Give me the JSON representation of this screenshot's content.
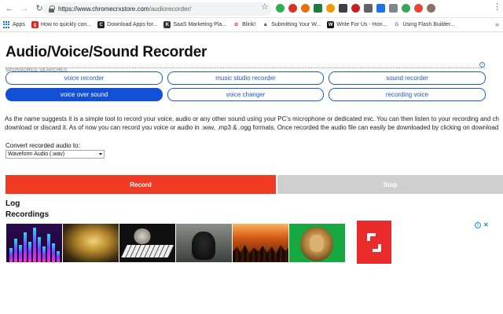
{
  "browser": {
    "url_host": "https://www.chromecrxstore.com",
    "url_path": "/audiorecorder/",
    "back_icon": "back-arrow-icon",
    "forward_icon": "forward-arrow-icon",
    "reload_icon": "reload-icon",
    "bookmarks": [
      {
        "label": "Apps",
        "favicon_color": "#1a73e8"
      },
      {
        "label": "How to quickly con...",
        "favicon_color": "#e62117",
        "favicon_text": "g"
      },
      {
        "label": "Download Apps for...",
        "favicon_color": "#222222",
        "favicon_text": "C"
      },
      {
        "label": "SaaS Marketing Pla...",
        "favicon_color": "#333333",
        "favicon_text": "K"
      },
      {
        "label": "Blink!",
        "favicon_color": "#ffffff",
        "favicon_text": "✿"
      },
      {
        "label": "Submitting Your W...",
        "favicon_color": "#ffffff",
        "favicon_text": "a"
      },
      {
        "label": "Write For Us - Hon...",
        "favicon_color": "#111111",
        "favicon_text": "W"
      },
      {
        "label": "Using Flash Builder...",
        "favicon_color": "#ffffff",
        "favicon_text": "G"
      }
    ],
    "more_label": "»"
  },
  "page": {
    "title": "Audio/Voice/Sound Recorder",
    "sponsored_label": "SPONSORED SEARCHES",
    "ad_links": [
      {
        "label": "voice recorder"
      },
      {
        "label": "music studio recorder"
      },
      {
        "label": "sound recorder"
      },
      {
        "label": "voice over sound"
      },
      {
        "label": "voice changer"
      },
      {
        "label": "recording voice"
      }
    ],
    "description_line1": "As the name suggests it is a simple tool to record your voice, audio or any other sound using your PC's microphone or dedicated mic. You can then listen to your recording and ch",
    "description_line2": "download or discard it. As of now you can record you voice or audio in .wav, .mp3 & .ogg formats. Once recorded the audio file can easily be downloaded by clicking on download",
    "convert_label": "Convert recorded audio to:",
    "format_selected": "Waveform Audio (.wav)",
    "record_label": "Record",
    "stop_label": "Stop",
    "log_heading": "Log",
    "recordings_heading": "Recordings"
  },
  "colors": {
    "record": "#ef3b24",
    "stop": "#cfcfcf",
    "link_blue": "#1f57c3",
    "active_link_bg": "#1450d6",
    "ad_logo": "#ea2b2b"
  }
}
